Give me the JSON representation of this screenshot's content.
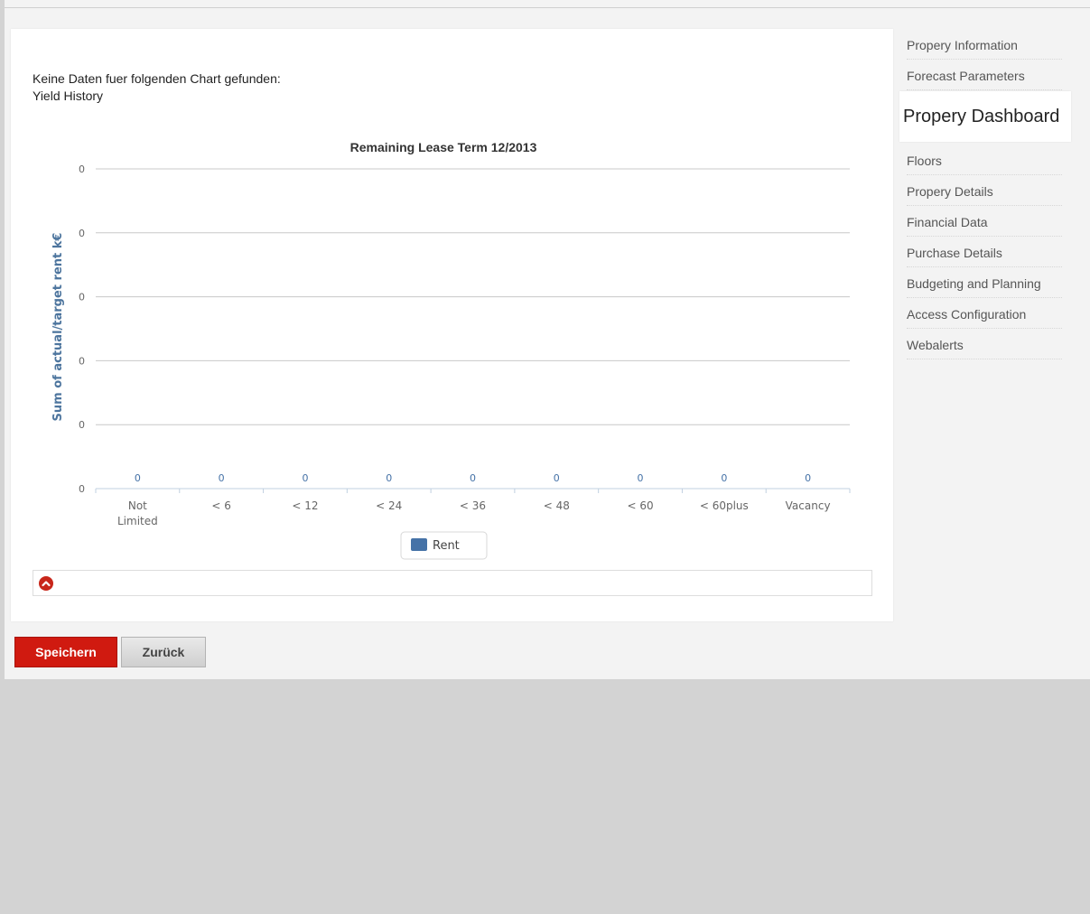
{
  "message": {
    "line1": "Keine Daten fuer folgenden Chart gefunden:",
    "line2": "Yield History"
  },
  "chart_data": {
    "type": "bar",
    "title": "Remaining Lease Term 12/2013",
    "ylabel": "Sum of actual/target rent k€",
    "xlabel": "",
    "categories": [
      "Not Limited",
      "< 6",
      "< 12",
      "< 24",
      "< 36",
      "< 48",
      "< 60",
      "< 60plus",
      "Vacancy"
    ],
    "series": [
      {
        "name": "Rent",
        "values": [
          0,
          0,
          0,
          0,
          0,
          0,
          0,
          0,
          0
        ],
        "color": "#4572a7"
      }
    ],
    "yticks": [
      "0",
      "0",
      "0",
      "0",
      "0",
      "0"
    ],
    "grid": true,
    "legend": "bottom-center"
  },
  "sidebar": {
    "items": [
      {
        "label": "Propery Information",
        "active": false
      },
      {
        "label": "Forecast Parameters",
        "active": false
      },
      {
        "label": "Propery Dashboard",
        "active": true
      },
      {
        "label": "Floors",
        "active": false
      },
      {
        "label": "Propery Details",
        "active": false
      },
      {
        "label": "Financial Data",
        "active": false
      },
      {
        "label": "Purchase Details",
        "active": false
      },
      {
        "label": "Budgeting and Planning",
        "active": false
      },
      {
        "label": "Access Configuration",
        "active": false
      },
      {
        "label": "Webalerts",
        "active": false
      }
    ]
  },
  "buttons": {
    "save": "Speichern",
    "back": "Zurück"
  },
  "colors": {
    "accent": "#d01a10",
    "series": "#4572a7"
  }
}
